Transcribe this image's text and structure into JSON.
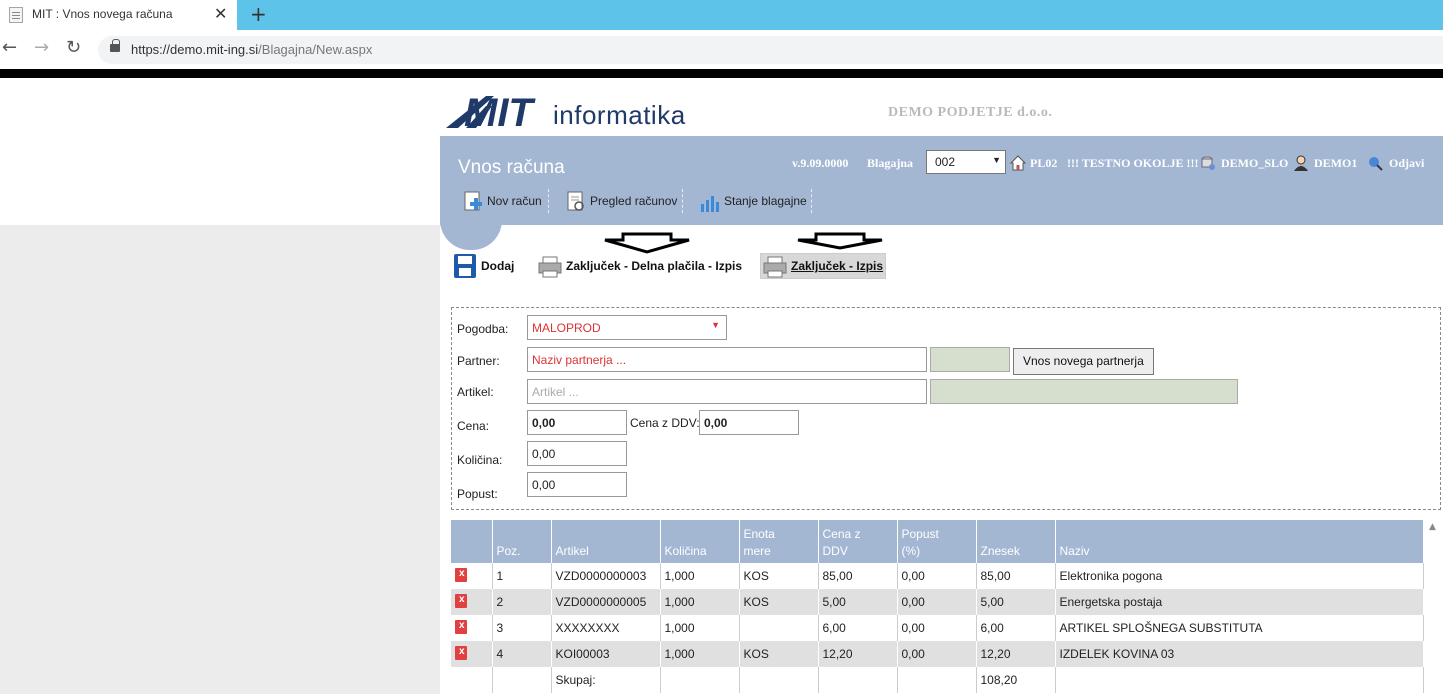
{
  "browser": {
    "tab_title": "MIT : Vnos novega računa",
    "url_host": "https://demo.mit-ing.si",
    "url_path": "/Blagajna/New.aspx"
  },
  "header": {
    "logo_text": "informatika",
    "company": "DEMO PODJETJE d.o.o.",
    "page_title": "Vnos računa",
    "version": "v.9.09.0000",
    "blagajna_label": "Blagajna",
    "blagajna_value": "002",
    "location": "PL02",
    "env": "!!! TESTNO OKOLJE !!!",
    "db": "DEMO_SLO",
    "user": "DEMO1",
    "logout": "Odjavi"
  },
  "menu": {
    "new_invoice": "Nov račun",
    "review": "Pregled računov",
    "balance": "Stanje blagajne"
  },
  "actions": {
    "add": "Dodaj",
    "close_partial": "Zaključek - Delna plačila - Izpis",
    "close_print": "Zaključek - Izpis"
  },
  "form": {
    "contract_label": "Pogodba:",
    "contract_value": "MALOPROD",
    "partner_label": "Partner:",
    "partner_placeholder": "Naziv partnerja ...",
    "new_partner_button": "Vnos novega partnerja",
    "article_label": "Artikel:",
    "article_placeholder": "Artikel ...",
    "price_label": "Cena:",
    "price_value": "0,00",
    "price_vat_label": "Cena z DDV:",
    "price_vat_value": "0,00",
    "qty_label": "Količina:",
    "qty_value": "0,00",
    "discount_label": "Popust:",
    "discount_value": "0,00"
  },
  "table": {
    "headers": {
      "pos": "Poz.",
      "article": "Artikel",
      "qty": "Količina",
      "unit1": "Enota",
      "unit2": "mere",
      "price1": "Cena z",
      "price2": "DDV",
      "disc1": "Popust",
      "disc2": "(%)",
      "amount": "Znesek",
      "name": "Naziv"
    },
    "rows": [
      {
        "pos": "1",
        "article": "VZD0000000003",
        "qty": "1,000",
        "unit": "KOS",
        "price": "85,00",
        "disc": "0,00",
        "amount": "85,00",
        "name": "Elektronika pogona"
      },
      {
        "pos": "2",
        "article": "VZD0000000005",
        "qty": "1,000",
        "unit": "KOS",
        "price": "5,00",
        "disc": "0,00",
        "amount": "5,00",
        "name": "Energetska postaja"
      },
      {
        "pos": "3",
        "article": "XXXXXXXX",
        "qty": "1,000",
        "unit": "",
        "price": "6,00",
        "disc": "0,00",
        "amount": "6,00",
        "name": "ARTIKEL SPLOŠNEGA SUBSTITUTA"
      },
      {
        "pos": "4",
        "article": "KOI00003",
        "qty": "1,000",
        "unit": "KOS",
        "price": "12,20",
        "disc": "0,00",
        "amount": "12,20",
        "name": "IZDELEK KOVINA 03"
      }
    ],
    "sum_label": "Skupaj:",
    "sum_value": "108,20"
  },
  "colors": {
    "banner": "#a3b7d3",
    "brand": "#1f3a68",
    "chrome_tabbar": "#5ec3e8",
    "required_text": "#dd3333",
    "readonly_field": "#d6dfcd"
  }
}
